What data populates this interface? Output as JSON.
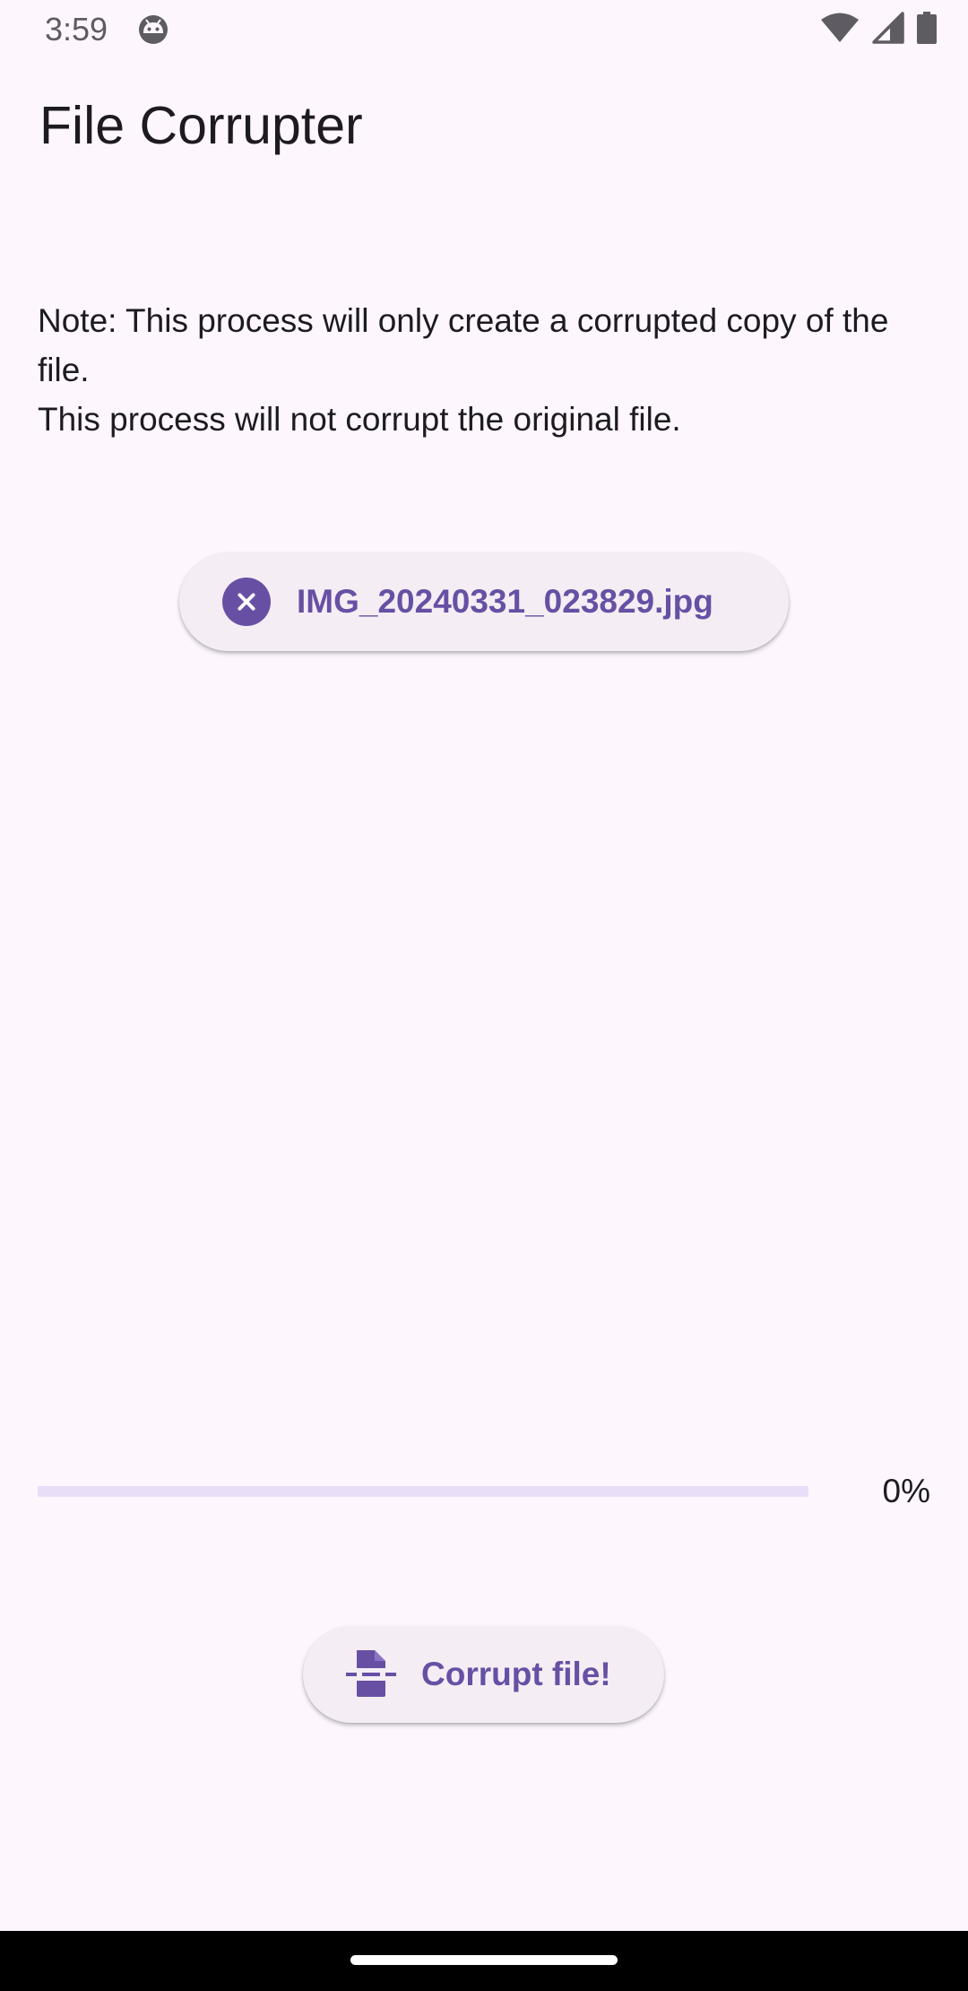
{
  "status_bar": {
    "time": "3:59",
    "app_icon": "android-robot-icon",
    "wifi_icon": "wifi-icon",
    "signal_icon": "cell-signal-icon",
    "battery_icon": "battery-icon"
  },
  "app_bar": {
    "title": "File Corrupter"
  },
  "note": {
    "line1": "Note: This process will only create a corrupted copy of the file.",
    "line2": "This process will not corrupt the original file."
  },
  "file_chip": {
    "icon": "close-circle-icon",
    "label": "IMG_20240331_023829.jpg"
  },
  "progress": {
    "value": 0,
    "text": "0%"
  },
  "corrupt_button": {
    "icon": "file-shredder-icon",
    "label": "Corrupt file!"
  },
  "colors": {
    "background": "#fdf7fd",
    "accent": "#6750a4",
    "track": "#e8def8",
    "chip_surface": "#f4eef4",
    "text": "#1d1b20"
  }
}
